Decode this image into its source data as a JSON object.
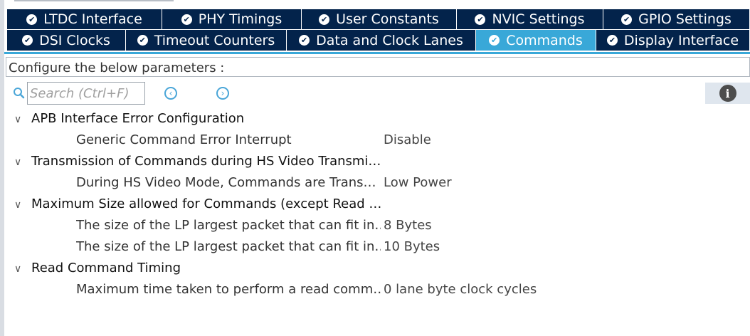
{
  "tabs_row1": [
    {
      "label": "LTDC Interface"
    },
    {
      "label": "PHY Timings"
    },
    {
      "label": "User Constants"
    },
    {
      "label": "NVIC Settings"
    },
    {
      "label": "GPIO Settings"
    }
  ],
  "tabs_row2": [
    {
      "label": "DSI Clocks"
    },
    {
      "label": "Timeout Counters"
    },
    {
      "label": "Data and Clock Lanes"
    },
    {
      "label": "Commands",
      "active": true
    },
    {
      "label": "Display Interface"
    }
  ],
  "configure_label": "Configure the below parameters :",
  "search": {
    "placeholder": "Search (Ctrl+F)"
  },
  "sections": [
    {
      "title": "APB Interface Error Configuration",
      "params": [
        {
          "name": "Generic Command Error Interrupt",
          "value": "Disable"
        }
      ]
    },
    {
      "title": "Transmission of Commands during HS Video Transmi…",
      "params": [
        {
          "name": "During HS Video Mode, Commands are Trans…",
          "value": "Low Power"
        }
      ]
    },
    {
      "title": "Maximum Size allowed for Commands (except Read …",
      "params": [
        {
          "name": "The size of the LP largest packet that can fit in…",
          "value": "8 Bytes"
        },
        {
          "name": "The size of the LP largest packet that can fit in…",
          "value": "10 Bytes"
        }
      ]
    },
    {
      "title": "Read Command Timing",
      "params": [
        {
          "name": "Maximum time taken to perform a read comm…",
          "value": "0 lane byte clock cycles"
        }
      ]
    }
  ],
  "colors": {
    "tab_bg": "#03234b",
    "tab_active": "#39a8d8",
    "accent": "#4aa6d8"
  }
}
